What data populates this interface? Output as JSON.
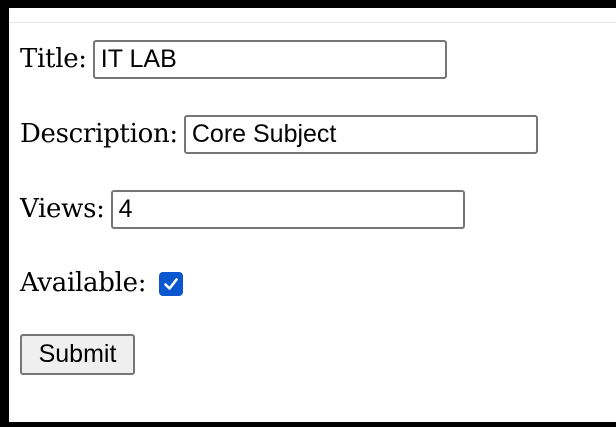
{
  "form": {
    "title": {
      "label": "Title:",
      "value": "IT LAB"
    },
    "description": {
      "label": "Description:",
      "value": "Core Subject"
    },
    "views": {
      "label": "Views:",
      "value": "4"
    },
    "available": {
      "label": "Available:",
      "checked": true
    },
    "submit_label": "Submit"
  },
  "colors": {
    "checkbox_accent": "#0b57d0",
    "input_border": "#767676",
    "button_background": "#efefef"
  }
}
